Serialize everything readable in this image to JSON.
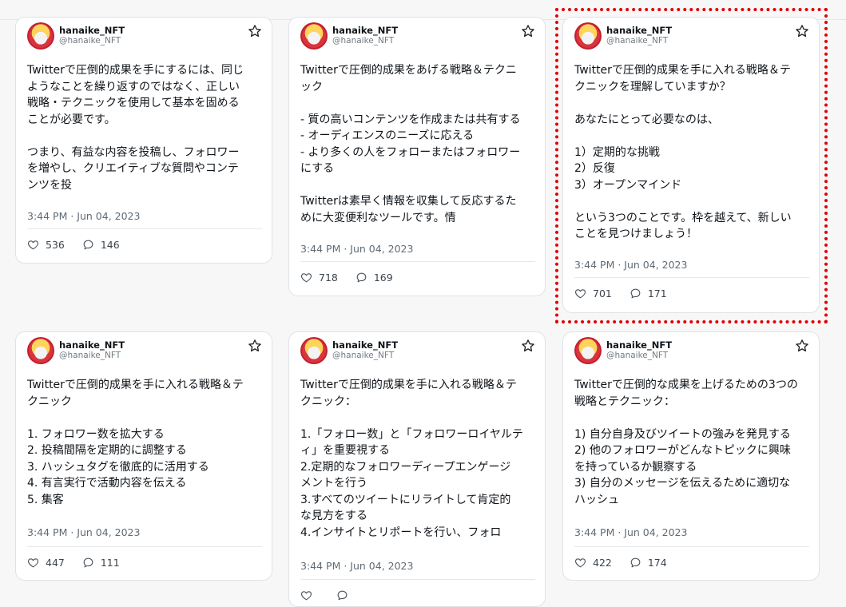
{
  "colors": {
    "highlight": "#e10000",
    "card_border": "#dfe3e6",
    "muted": "#5f6b75"
  },
  "tweets": [
    {
      "name": "hanaike_NFT",
      "handle": "@hanaike_NFT",
      "text": "Twitterで圧倒的成果を手にするには、同じ\nようなことを繰り返すのではなく、正しい\n戦略・テクニックを使用して基本を固める\nことが必要です。\n\nつまり、有益な内容を投稿し、フォロワー\nを増やし、クリエイティブな質問やコンテ\nンツを投",
      "time": "3:44 PM · Jun 04, 2023",
      "likes": "536",
      "replies": "146"
    },
    {
      "name": "hanaike_NFT",
      "handle": "@hanaike_NFT",
      "text": "Twitterで圧倒的成果をあげる戦略＆テクニ\nック\n\n- 質の高いコンテンツを作成または共有する\n- オーディエンスのニーズに応える\n- より多くの人をフォローまたはフォロワー\nにする\n\nTwitterは素早く情報を収集して反応するた\nめに大変便利なツールです。情",
      "time": "3:44 PM · Jun 04, 2023",
      "likes": "718",
      "replies": "169"
    },
    {
      "name": "hanaike_NFT",
      "handle": "@hanaike_NFT",
      "text": "Twitterで圧倒的成果を手に入れる戦略＆テ\nクニックを理解していますか？\n\nあなたにとって必要なのは、\n\n1）定期的な挑戦\n2）反復\n3）オープンマインド\n\nという3つのことです。枠を越えて、新しい\nことを見つけましょう！",
      "time": "3:44 PM · Jun 04, 2023",
      "likes": "701",
      "replies": "171"
    },
    {
      "name": "hanaike_NFT",
      "handle": "@hanaike_NFT",
      "text": "Twitterで圧倒的成果を手に入れる戦略＆テ\nクニック\n\n1.  フォロワー数を拡大する\n2.  投稿間隔を定期的に調整する\n3.  ハッシュタグを徹底的に活用する\n4.  有言実行で活動内容を伝える\n5.  集客",
      "time": "3:44 PM · Jun 04, 2023",
      "likes": "447",
      "replies": "111"
    },
    {
      "name": "hanaike_NFT",
      "handle": "@hanaike_NFT",
      "text": "Twitterで圧倒的成果を手に入れる戦略＆テ\nクニック：\n\n1.「フォロー数」と「フォロワーロイヤルテ\nィ」を重要視する\n2.定期的なフォロワーディープエンゲージ\nメントを行う\n3.すべてのツイートにリライトして肯定的\nな見方をする\n4.インサイトとリポートを行い、フォロ",
      "time": "3:44 PM · Jun 04, 2023",
      "likes": "",
      "replies": ""
    },
    {
      "name": "hanaike_NFT",
      "handle": "@hanaike_NFT",
      "text": "Twitterで圧倒的な成果を上げるための3つの\n戦略とテクニック：\n\n1) 自分自身及びツイートの強みを発見する\n2) 他のフォロワーがどんなトピックに興味\nを持っているか観察する\n3) 自分のメッセージを伝えるために適切な\nハッシュ",
      "time": "3:44 PM · Jun 04, 2023",
      "likes": "422",
      "replies": "174"
    }
  ]
}
